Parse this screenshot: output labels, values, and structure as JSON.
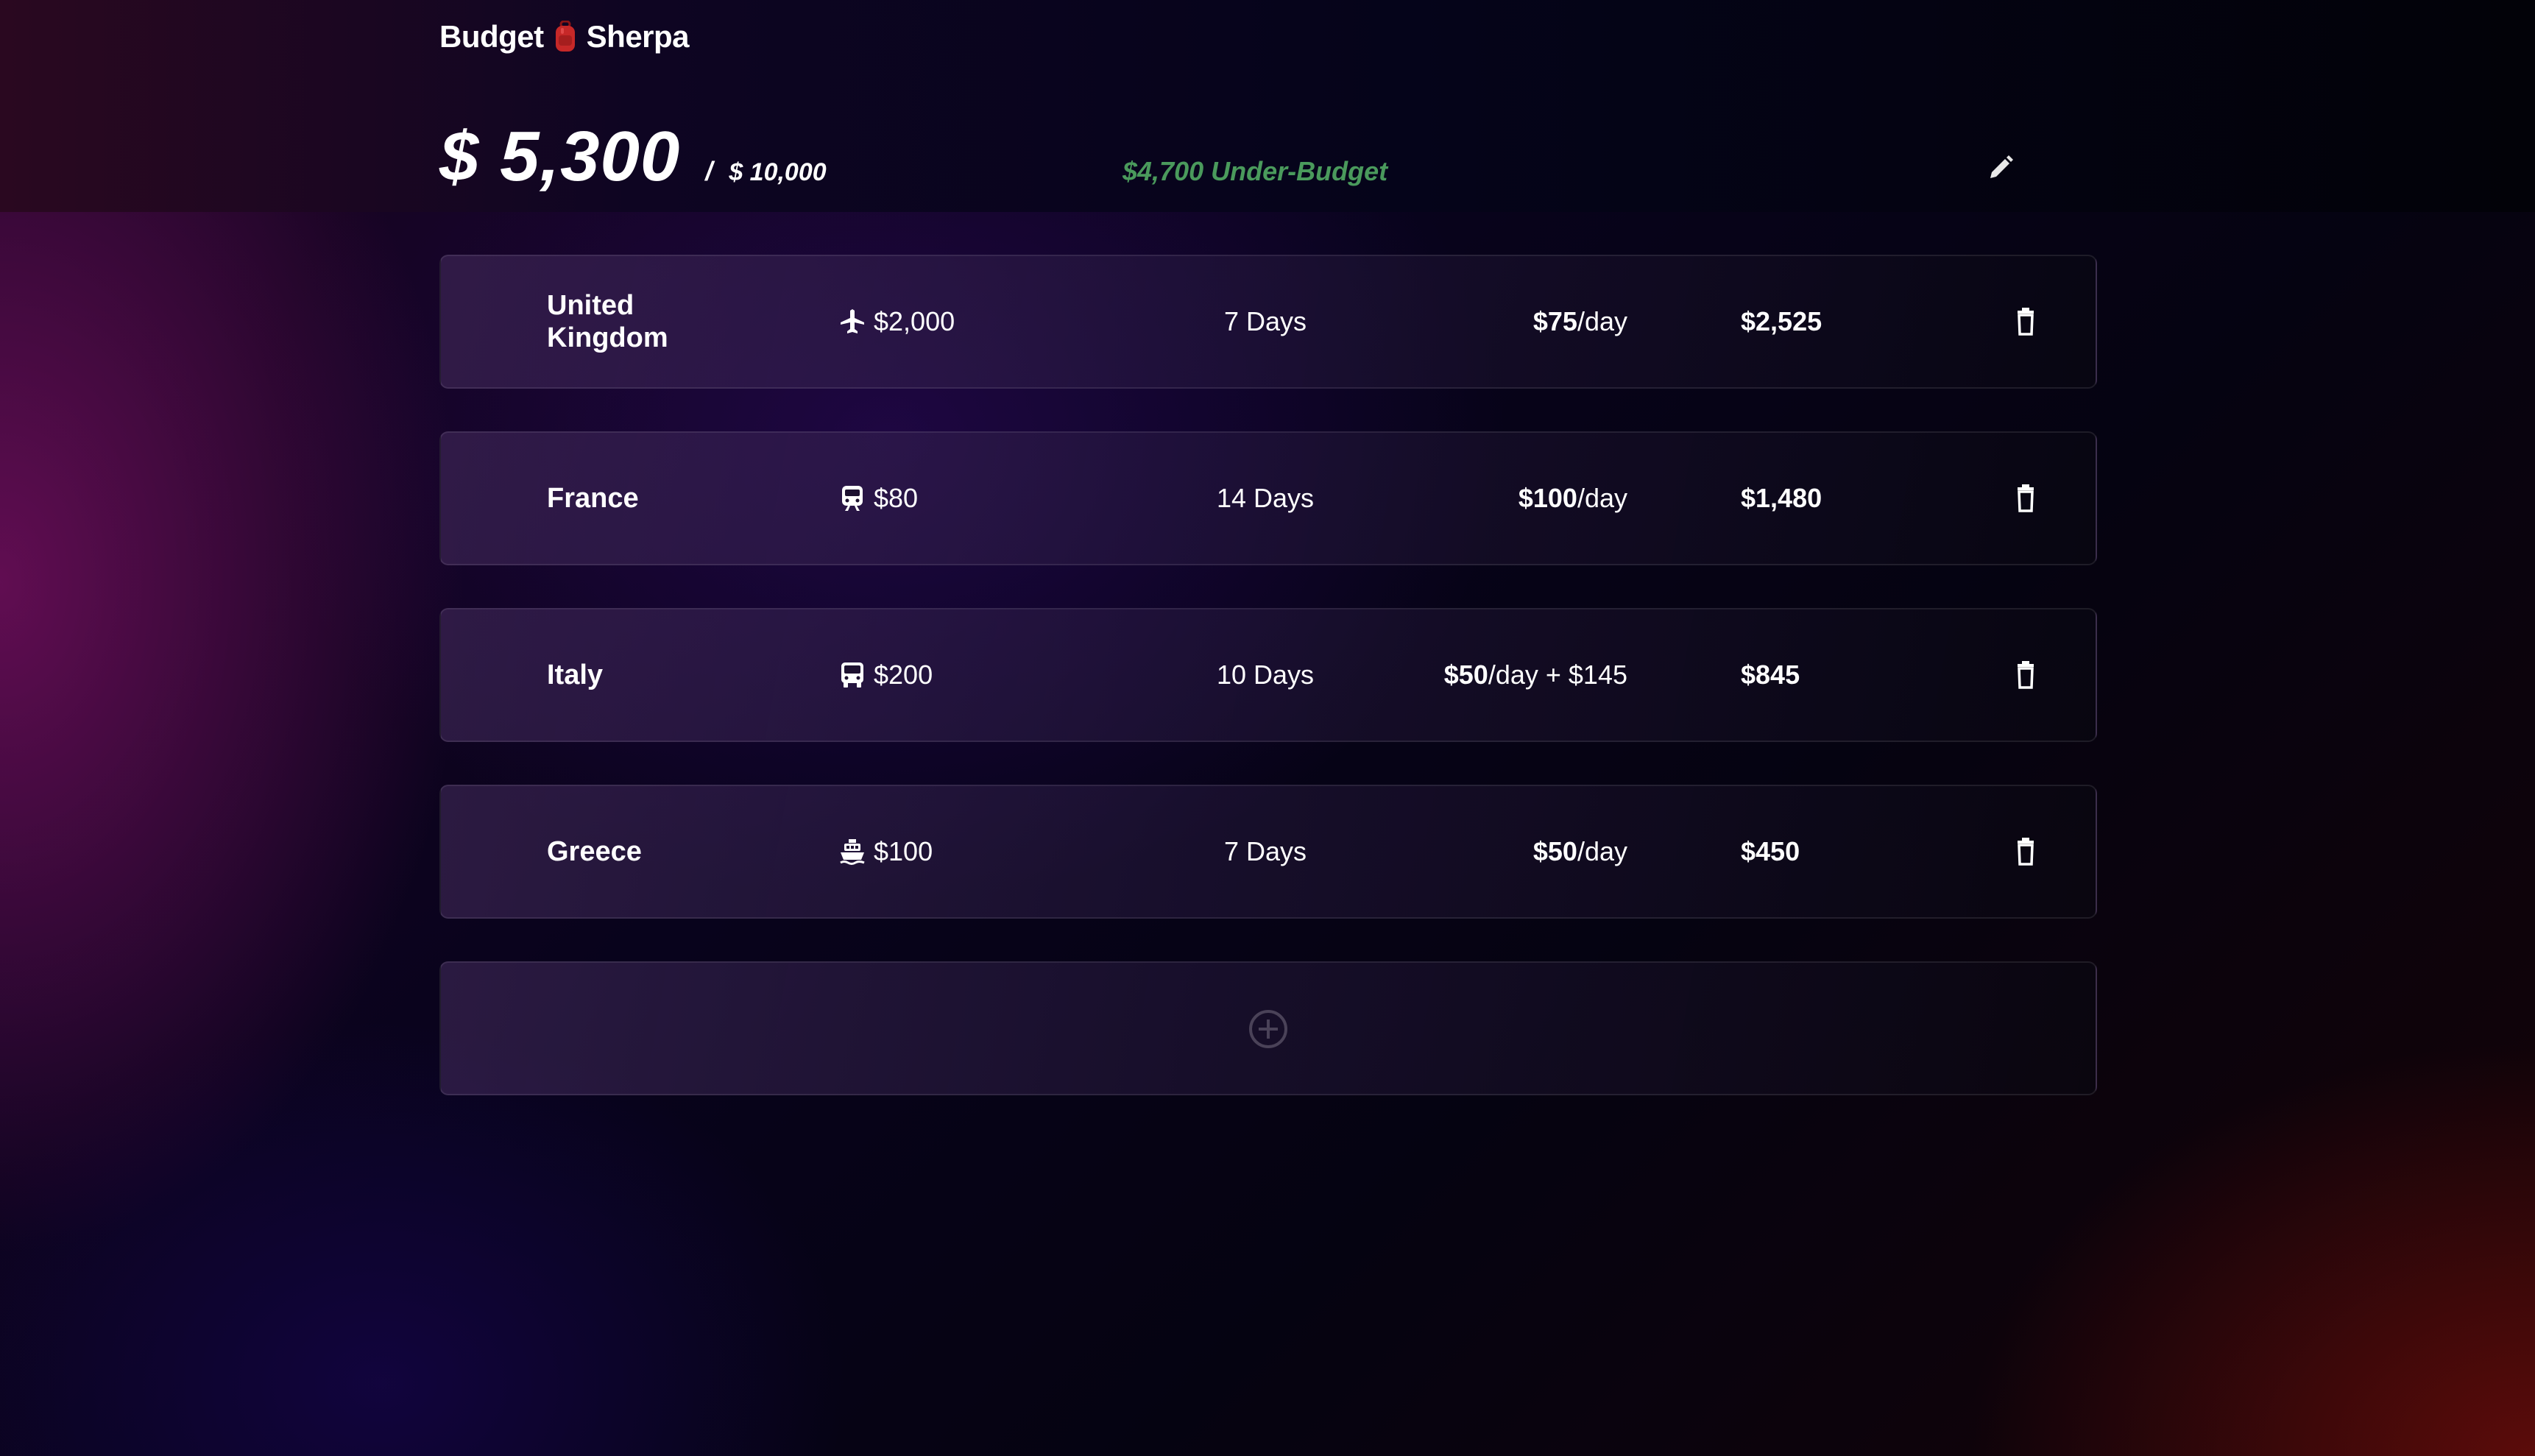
{
  "app": {
    "brand_left": "Budget",
    "brand_right": "Sherpa",
    "brand_icon": "backpack-icon"
  },
  "summary": {
    "spent": "$ 5,300",
    "separator": "/",
    "budget": "$ 10,000",
    "status": "$4,700 Under-Budget",
    "status_color": "#4a9a5c"
  },
  "trips": [
    {
      "country": "United Kingdom",
      "transport_icon": "airplane-icon",
      "transport_cost": "$2,000",
      "days": "7 Days",
      "rate": "$75",
      "rate_suffix": "/day",
      "total": "$2,525"
    },
    {
      "country": "France",
      "transport_icon": "train-icon",
      "transport_cost": "$80",
      "days": "14 Days",
      "rate": "$100",
      "rate_suffix": "/day",
      "total": "$1,480"
    },
    {
      "country": "Italy",
      "transport_icon": "bus-icon",
      "transport_cost": "$200",
      "days": "10 Days",
      "rate": "$50",
      "rate_suffix": "/day + $145",
      "total": "$845"
    },
    {
      "country": "Greece",
      "transport_icon": "ferry-icon",
      "transport_cost": "$100",
      "days": "7 Days",
      "rate": "$50",
      "rate_suffix": "/day",
      "total": "$450"
    }
  ],
  "add_icon": "plus-circle-icon",
  "delete_icon": "trash-icon",
  "edit_icon": "pencil-icon"
}
